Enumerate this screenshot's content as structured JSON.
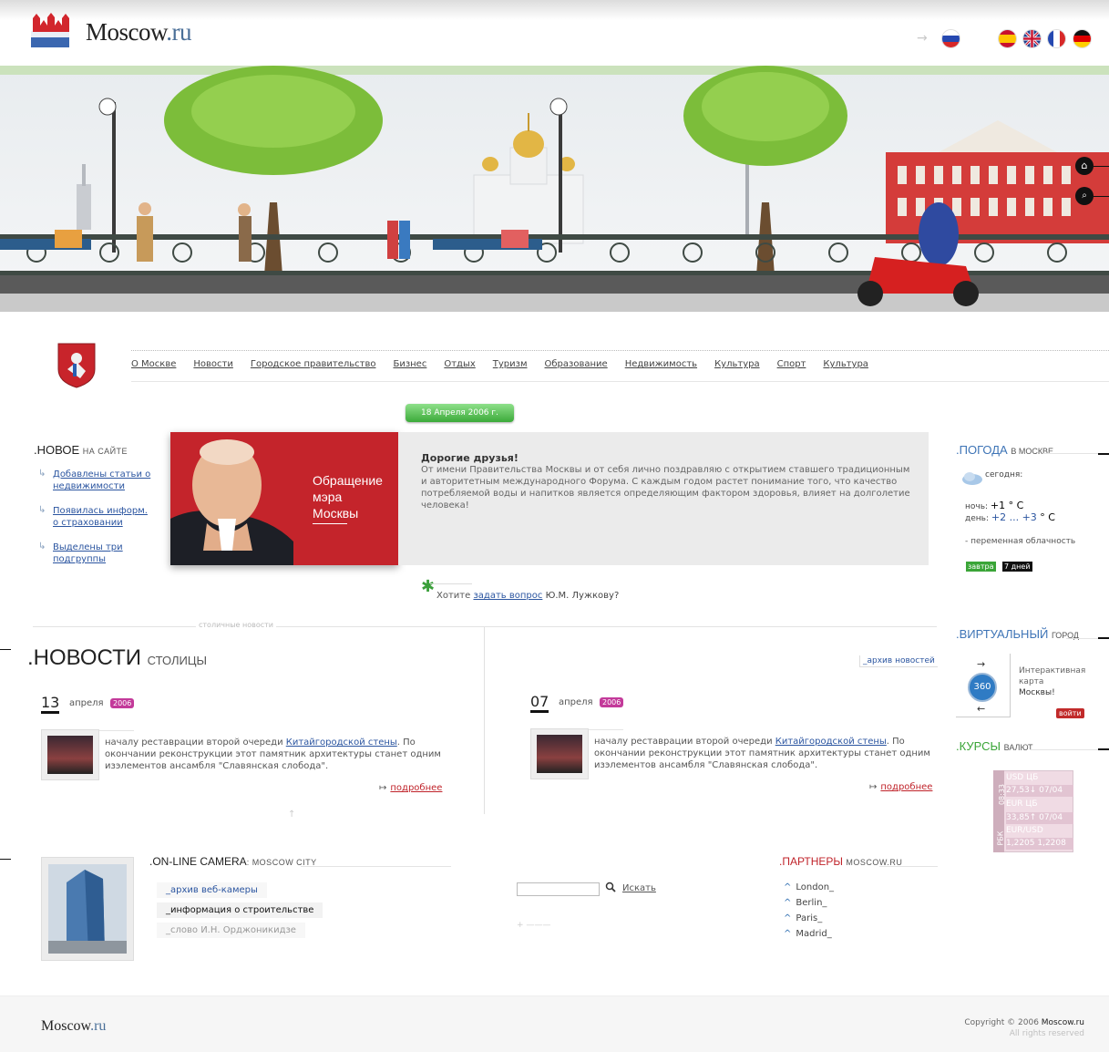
{
  "header": {
    "logo_main": "Moscow",
    "logo_suffix": ".ru",
    "languages": [
      "ru",
      "es",
      "en",
      "fr",
      "de"
    ]
  },
  "nav": {
    "items": [
      "О Москве",
      "Новости",
      "Городское правительство",
      "Бизнес",
      "Отдых",
      "Туризм",
      "Образование",
      "Недвижимость",
      "Культура",
      "Спорт",
      "Культура"
    ]
  },
  "new_section": {
    "title": ".НОВОЕ",
    "subtitle": "НА САЙТЕ",
    "items": [
      "Добавлены статьи о недвижимости",
      "Появилась информ. о страховании",
      "Выделены три подгруппы"
    ]
  },
  "mayor": {
    "date": "18 Апреля 2006 г.",
    "caption": "Обращение мэра Москвы",
    "greeting_title": "Дорогие друзья!",
    "greeting_text": "От имени Правительства Москвы и от себя лично поздравляю с открытием ставшего традиционным и авторитетным международного Форума. С каждым годом растет понимание того, что качество потребляемой воды и напитков является определяющим фактором здоровья, влияет на долголетие человека!",
    "ask_prefix": "Хотите",
    "ask_link": "задать вопрос",
    "ask_suffix": "Ю.М. Лужкову?"
  },
  "news": {
    "top_label": "столичные новости",
    "title": ".НОВОСТИ",
    "subtitle": "СТОЛИЦЫ",
    "archive": "_архив новостей",
    "items": [
      {
        "day": "13",
        "month": "апреля",
        "year": "2006",
        "text_before": "началу реставрации второй очереди ",
        "link": "Китайгородской стены",
        "text_after": ". По окончании реконструкции этот памятник архитектуры станет одним изэлементов ансамбля \"Славянская слобода\".",
        "more": "подробнее"
      },
      {
        "day": "07",
        "month": "апреля",
        "year": "2006",
        "text_before": "началу реставрации второй очереди ",
        "link": "Китайгородской стены",
        "text_after": ". По окончании реконструкции этот памятник архитектуры станет одним изэлементов ансамбля \"Славянская слобода\".",
        "more": "подробнее"
      }
    ]
  },
  "weather": {
    "title": ".ПОГОДА",
    "subtitle": "В МОСКВЕ",
    "today_label": "сегодня:",
    "night_label": "ночь:",
    "night_value": "+1 ° С",
    "day_label": "день:",
    "day_from": "+2",
    "day_sep": " ... ",
    "day_to": "+3",
    "day_unit": " ° С",
    "description": "- переменная облачность",
    "tomorrow": "завтра",
    "week": "7 дней"
  },
  "virtual": {
    "title": ".ВИРТУАЛЬНЫЙ",
    "subtitle": "ГОРОД",
    "badge": "360",
    "text": "Интерактивная карта",
    "text_bold": "Москвы!",
    "login": "войти"
  },
  "rates": {
    "title": ".КУРСЫ",
    "subtitle": "ВАЛЮТ",
    "side_top": "08:33",
    "side_bottom": "РБК",
    "rows": [
      "USD ЦБ",
      "27,53↓ 07/04",
      "EUR ЦБ",
      "33,85↑ 07/04",
      "EUR/USD",
      "1,2205 1,2208"
    ]
  },
  "camera": {
    "title": ".ON-LINE CAMERA",
    "subtitle": ": MOSCOW CITY",
    "links": [
      "_архив веб-камеры",
      "_информация о строительстве",
      "_слово И.Н. Орджоникидзе"
    ]
  },
  "search": {
    "button": "Искать",
    "placeholder": ""
  },
  "partners": {
    "title": ".ПАРТНЕРЫ",
    "subtitle": "MOSCOW.RU",
    "items": [
      "London_",
      "Berlin_",
      "Paris_",
      "Madrid_"
    ]
  },
  "footer": {
    "logo_main": "Moscow",
    "logo_suffix": ".ru",
    "copyright_prefix": "Copyright © 2006 ",
    "copyright_site": "Moscow.ru",
    "rights": "All rights reserved"
  },
  "colors": {
    "brand_red": "#c4242b",
    "link_blue": "#2b55a0",
    "accent_green": "#3caa3a"
  }
}
